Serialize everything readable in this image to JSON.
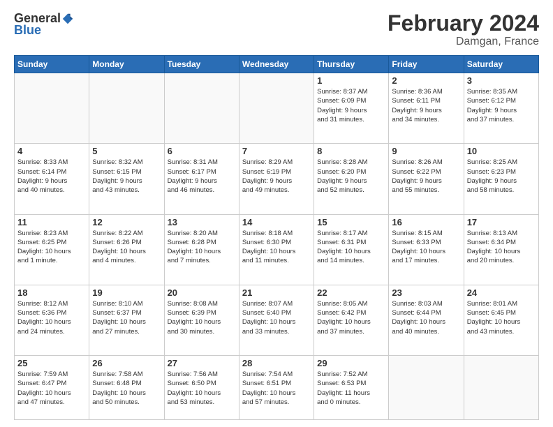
{
  "logo": {
    "text_general": "General",
    "text_blue": "Blue"
  },
  "title": "February 2024",
  "subtitle": "Damgan, France",
  "weekdays": [
    "Sunday",
    "Monday",
    "Tuesday",
    "Wednesday",
    "Thursday",
    "Friday",
    "Saturday"
  ],
  "weeks": [
    [
      {
        "day": "",
        "info": ""
      },
      {
        "day": "",
        "info": ""
      },
      {
        "day": "",
        "info": ""
      },
      {
        "day": "",
        "info": ""
      },
      {
        "day": "1",
        "info": "Sunrise: 8:37 AM\nSunset: 6:09 PM\nDaylight: 9 hours\nand 31 minutes."
      },
      {
        "day": "2",
        "info": "Sunrise: 8:36 AM\nSunset: 6:11 PM\nDaylight: 9 hours\nand 34 minutes."
      },
      {
        "day": "3",
        "info": "Sunrise: 8:35 AM\nSunset: 6:12 PM\nDaylight: 9 hours\nand 37 minutes."
      }
    ],
    [
      {
        "day": "4",
        "info": "Sunrise: 8:33 AM\nSunset: 6:14 PM\nDaylight: 9 hours\nand 40 minutes."
      },
      {
        "day": "5",
        "info": "Sunrise: 8:32 AM\nSunset: 6:15 PM\nDaylight: 9 hours\nand 43 minutes."
      },
      {
        "day": "6",
        "info": "Sunrise: 8:31 AM\nSunset: 6:17 PM\nDaylight: 9 hours\nand 46 minutes."
      },
      {
        "day": "7",
        "info": "Sunrise: 8:29 AM\nSunset: 6:19 PM\nDaylight: 9 hours\nand 49 minutes."
      },
      {
        "day": "8",
        "info": "Sunrise: 8:28 AM\nSunset: 6:20 PM\nDaylight: 9 hours\nand 52 minutes."
      },
      {
        "day": "9",
        "info": "Sunrise: 8:26 AM\nSunset: 6:22 PM\nDaylight: 9 hours\nand 55 minutes."
      },
      {
        "day": "10",
        "info": "Sunrise: 8:25 AM\nSunset: 6:23 PM\nDaylight: 9 hours\nand 58 minutes."
      }
    ],
    [
      {
        "day": "11",
        "info": "Sunrise: 8:23 AM\nSunset: 6:25 PM\nDaylight: 10 hours\nand 1 minute."
      },
      {
        "day": "12",
        "info": "Sunrise: 8:22 AM\nSunset: 6:26 PM\nDaylight: 10 hours\nand 4 minutes."
      },
      {
        "day": "13",
        "info": "Sunrise: 8:20 AM\nSunset: 6:28 PM\nDaylight: 10 hours\nand 7 minutes."
      },
      {
        "day": "14",
        "info": "Sunrise: 8:18 AM\nSunset: 6:30 PM\nDaylight: 10 hours\nand 11 minutes."
      },
      {
        "day": "15",
        "info": "Sunrise: 8:17 AM\nSunset: 6:31 PM\nDaylight: 10 hours\nand 14 minutes."
      },
      {
        "day": "16",
        "info": "Sunrise: 8:15 AM\nSunset: 6:33 PM\nDaylight: 10 hours\nand 17 minutes."
      },
      {
        "day": "17",
        "info": "Sunrise: 8:13 AM\nSunset: 6:34 PM\nDaylight: 10 hours\nand 20 minutes."
      }
    ],
    [
      {
        "day": "18",
        "info": "Sunrise: 8:12 AM\nSunset: 6:36 PM\nDaylight: 10 hours\nand 24 minutes."
      },
      {
        "day": "19",
        "info": "Sunrise: 8:10 AM\nSunset: 6:37 PM\nDaylight: 10 hours\nand 27 minutes."
      },
      {
        "day": "20",
        "info": "Sunrise: 8:08 AM\nSunset: 6:39 PM\nDaylight: 10 hours\nand 30 minutes."
      },
      {
        "day": "21",
        "info": "Sunrise: 8:07 AM\nSunset: 6:40 PM\nDaylight: 10 hours\nand 33 minutes."
      },
      {
        "day": "22",
        "info": "Sunrise: 8:05 AM\nSunset: 6:42 PM\nDaylight: 10 hours\nand 37 minutes."
      },
      {
        "day": "23",
        "info": "Sunrise: 8:03 AM\nSunset: 6:44 PM\nDaylight: 10 hours\nand 40 minutes."
      },
      {
        "day": "24",
        "info": "Sunrise: 8:01 AM\nSunset: 6:45 PM\nDaylight: 10 hours\nand 43 minutes."
      }
    ],
    [
      {
        "day": "25",
        "info": "Sunrise: 7:59 AM\nSunset: 6:47 PM\nDaylight: 10 hours\nand 47 minutes."
      },
      {
        "day": "26",
        "info": "Sunrise: 7:58 AM\nSunset: 6:48 PM\nDaylight: 10 hours\nand 50 minutes."
      },
      {
        "day": "27",
        "info": "Sunrise: 7:56 AM\nSunset: 6:50 PM\nDaylight: 10 hours\nand 53 minutes."
      },
      {
        "day": "28",
        "info": "Sunrise: 7:54 AM\nSunset: 6:51 PM\nDaylight: 10 hours\nand 57 minutes."
      },
      {
        "day": "29",
        "info": "Sunrise: 7:52 AM\nSunset: 6:53 PM\nDaylight: 11 hours\nand 0 minutes."
      },
      {
        "day": "",
        "info": ""
      },
      {
        "day": "",
        "info": ""
      }
    ]
  ]
}
